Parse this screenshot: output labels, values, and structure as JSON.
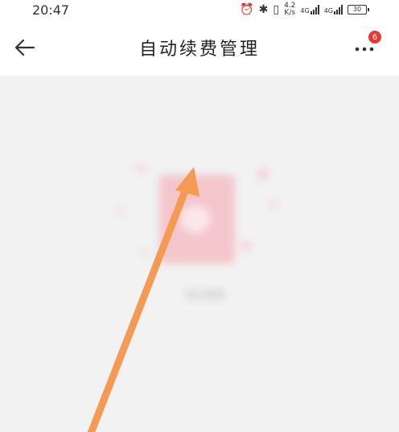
{
  "status_bar": {
    "time": "20:47",
    "net_speed_value": "4.2",
    "net_speed_unit": "K/s",
    "network_1": "4G",
    "network_2": "4G",
    "battery": "30"
  },
  "header": {
    "title": "自动续费管理",
    "more_badge": "6"
  },
  "empty_state": {
    "message": "暂无数据"
  },
  "colors": {
    "accent": "#e53935",
    "annotation_arrow": "#f59a55",
    "illustration": "#f4c6cc"
  }
}
